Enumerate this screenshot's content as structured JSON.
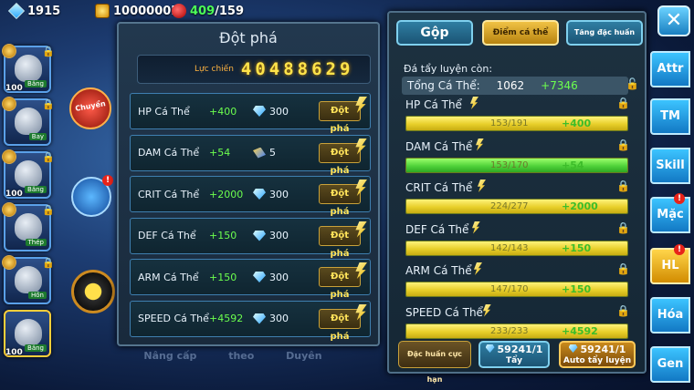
{
  "topbar": {
    "gems": "1915",
    "coins": "1000000k",
    "energy_current": "409",
    "energy_max": "/159"
  },
  "characters": [
    {
      "level": "100",
      "tag": "Băng",
      "selected": false
    },
    {
      "level": "",
      "tag": "Bay",
      "sub": "Lửa",
      "selected": false
    },
    {
      "level": "100",
      "tag": "Băng",
      "sub": "Rồng",
      "selected": false
    },
    {
      "level": "",
      "tag": "Thép",
      "sub": "Siêu",
      "selected": false
    },
    {
      "level": "",
      "tag": "Hồn",
      "sub": "Siêu",
      "selected": false
    },
    {
      "level": "100",
      "tag": "Băng",
      "sub": "Rồng",
      "selected": true
    }
  ],
  "background": {
    "red_badge": "Chuyển",
    "bottom_tabs": [
      "Nâng cấp",
      "theo",
      "Duyên"
    ]
  },
  "breakthrough_panel": {
    "title": "Đột phá",
    "power_label": "Lực chiến",
    "power_value": "40488629",
    "rows": [
      {
        "name": "HP Cá Thể",
        "bonus": "+400",
        "cost": "300",
        "cost_icon": "diamond-icon",
        "button": "Đột phá"
      },
      {
        "name": "DAM Cá Thể",
        "bonus": "+54",
        "cost": "5",
        "cost_icon": "crystal-icon",
        "button": "Đột phá"
      },
      {
        "name": "CRIT Cá Thể",
        "bonus": "+2000",
        "cost": "300",
        "cost_icon": "diamond-icon",
        "button": "Đột phá"
      },
      {
        "name": "DEF Cá Thể",
        "bonus": "+150",
        "cost": "300",
        "cost_icon": "diamond-icon",
        "button": "Đột phá"
      },
      {
        "name": "ARM Cá Thể",
        "bonus": "+150",
        "cost": "300",
        "cost_icon": "diamond-icon",
        "button": "Đột phá"
      },
      {
        "name": "SPEED Cá Thể",
        "bonus": "+4592",
        "cost": "300",
        "cost_icon": "diamond-icon",
        "button": "Đột phá"
      }
    ]
  },
  "stats_panel": {
    "tabs": [
      "Gộp",
      "Điểm cá thể",
      "Tăng đặc huấn"
    ],
    "active_tab": 1,
    "remaining_label": "Đá tẩy luyện còn:",
    "total": {
      "label": "Tổng Cá Thể:",
      "value": "1062",
      "add": "+7346"
    },
    "stats": [
      {
        "name": "HP Cá Thể",
        "current": "153/191",
        "add": "+400",
        "fill": 1.0,
        "green": false
      },
      {
        "name": "DAM Cá Thể",
        "current": "153/170",
        "add": "+54",
        "fill": 1.0,
        "green": true
      },
      {
        "name": "CRIT Cá Thể",
        "current": "224/277",
        "add": "+2000",
        "fill": 1.0,
        "green": false
      },
      {
        "name": "DEF Cá Thể",
        "current": "142/143",
        "add": "+150",
        "fill": 1.0,
        "green": false
      },
      {
        "name": "ARM Cá Thể",
        "current": "147/170",
        "add": "+150",
        "fill": 1.0,
        "green": false
      },
      {
        "name": "SPEED Cá Thể",
        "current": "233/233",
        "add": "+4592",
        "fill": 1.0,
        "green": false
      }
    ],
    "buttons": {
      "special": "Đặc huấn cực hạn",
      "wash_count": "59241/1",
      "wash_label": "Tẩy",
      "auto_count": "59241/1",
      "auto_label": "Auto tẩy luyện"
    }
  },
  "side_tabs": [
    {
      "label": "Attr",
      "active": false,
      "notif": false
    },
    {
      "label": "TM",
      "active": false,
      "notif": false
    },
    {
      "label": "Skill",
      "active": false,
      "notif": false
    },
    {
      "label": "Mặc",
      "active": false,
      "notif": true
    },
    {
      "label": "HL",
      "active": true,
      "notif": true
    },
    {
      "label": "Hóa",
      "active": false,
      "notif": false
    },
    {
      "label": "Gen",
      "active": false,
      "notif": false
    }
  ],
  "close_label": "✕",
  "colors": {
    "gold": "#ffe34a",
    "green": "#6cff4e",
    "accent_blue": "#3cc4ff"
  }
}
